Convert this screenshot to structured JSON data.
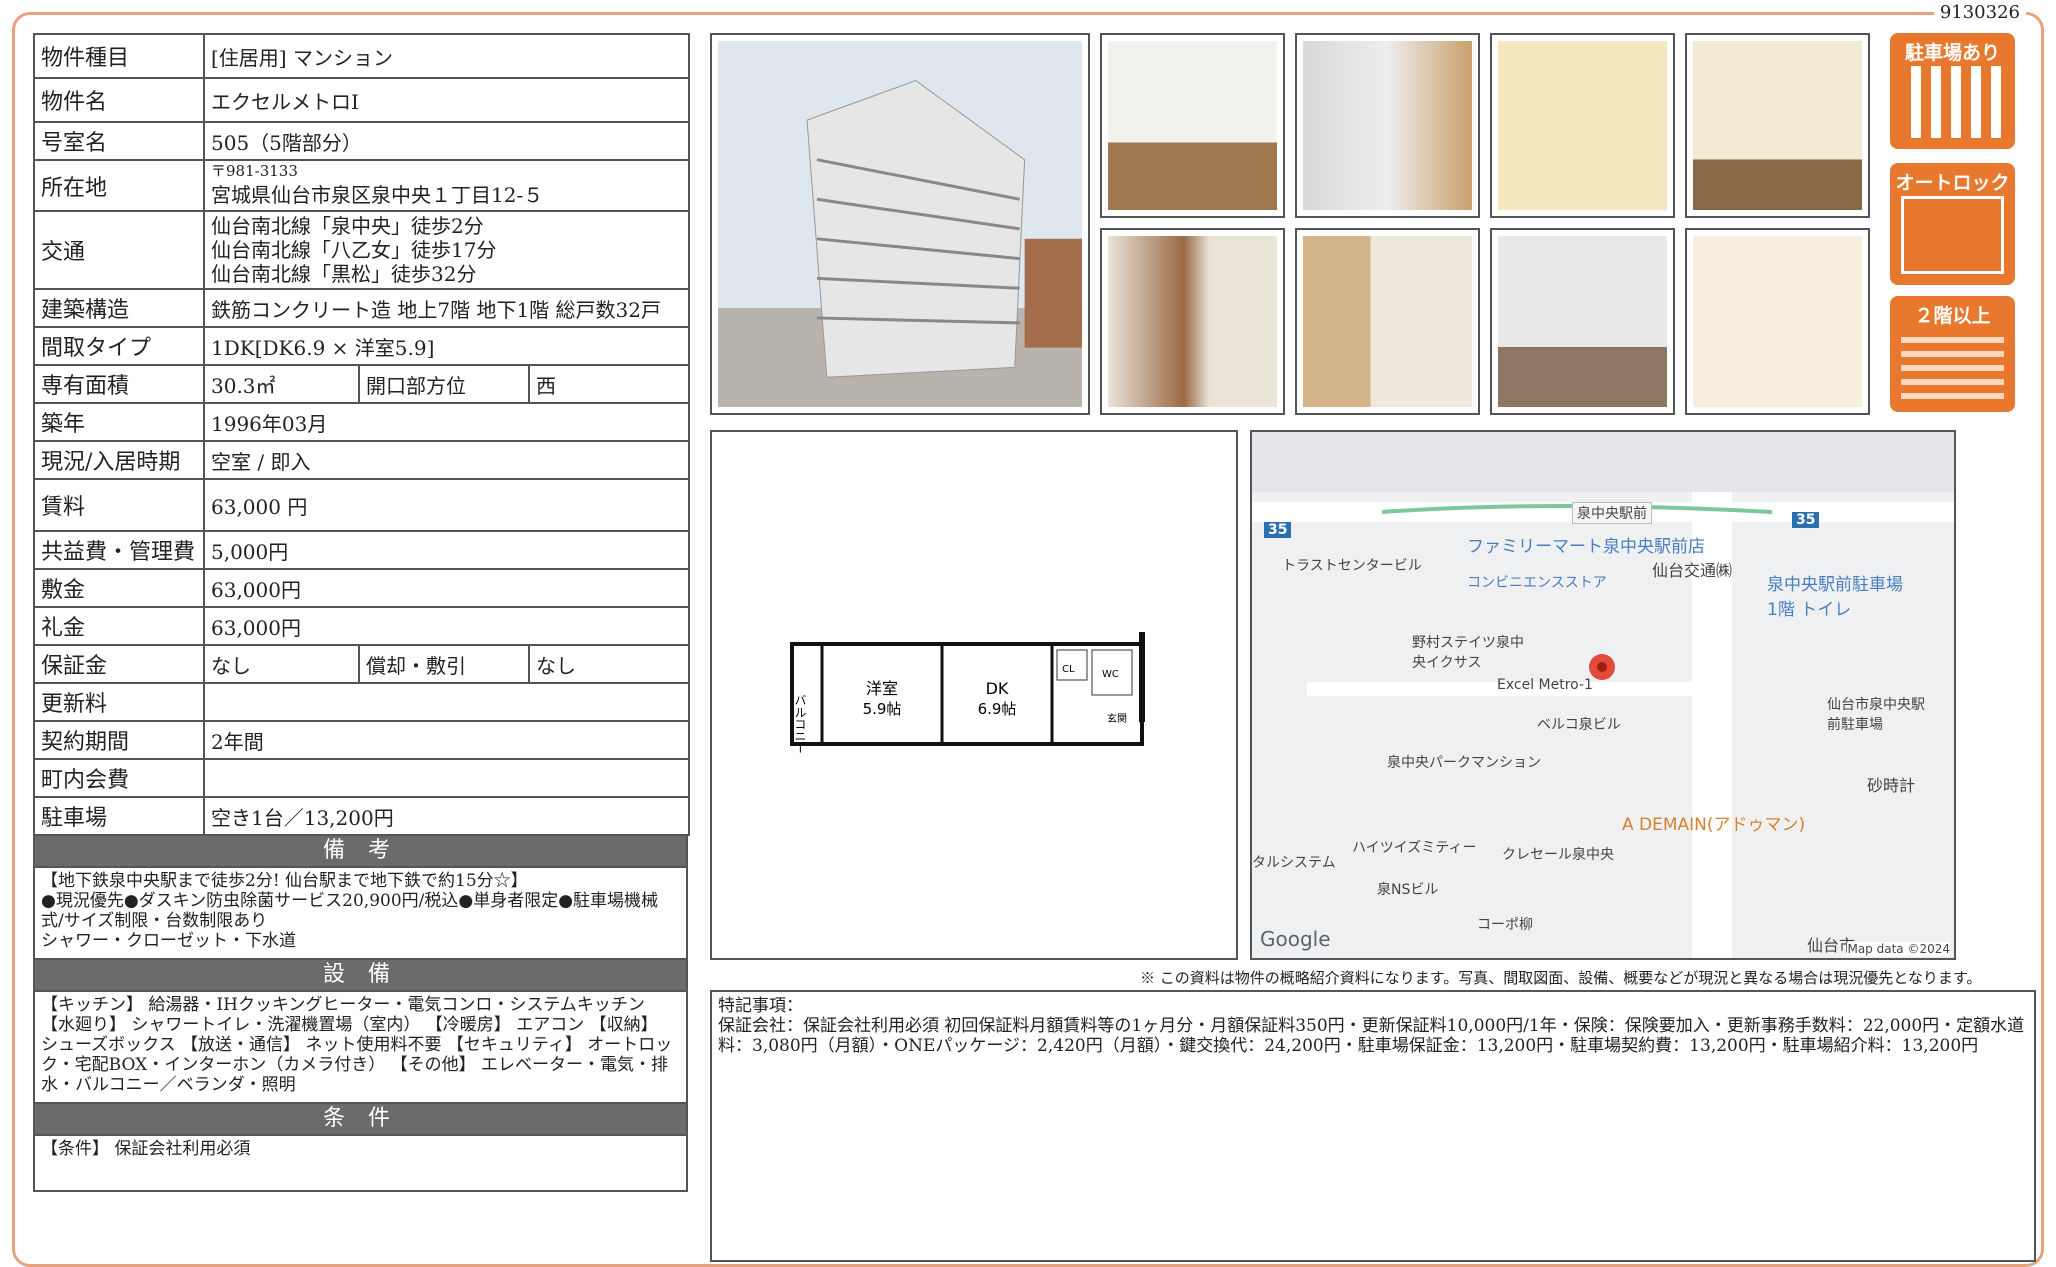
{
  "doc_id": "9130326",
  "property": {
    "type_label": "物件種目",
    "type_value": "[住居用] マンション",
    "name_label": "物件名",
    "name_value": "エクセルメトロI",
    "room_label": "号室名",
    "room_value": "505（5階部分）",
    "address_label": "所在地",
    "postal": "〒981-3133",
    "address_value": "宮城県仙台市泉区泉中央１丁目12-５",
    "transit_label": "交通",
    "transit": [
      "仙台南北線「泉中央」徒歩2分",
      "仙台南北線「八乙女」徒歩17分",
      "仙台南北線「黒松」徒歩32分"
    ],
    "structure_label": "建築構造",
    "structure_value": "鉄筋コンクリート造 地上7階 地下1階 総戸数32戸",
    "layout_label": "間取タイプ",
    "layout_value": "1DK[DK6.9 × 洋室5.9]",
    "area_label": "専有面積",
    "area_value": "30.3㎡",
    "direction_label": "開口部方位",
    "direction_value": "西",
    "built_label": "築年",
    "built_value": "1996年03月",
    "status_label": "現況/入居時期",
    "status_value": "空室 / 即入",
    "rent_label": "賃料",
    "rent_value": "63,000 円",
    "fee_label": "共益費・管理費",
    "fee_value": "5,000円",
    "deposit_label": "敷金",
    "deposit_value": "63,000円",
    "keymoney_label": "礼金",
    "keymoney_value": "63,000円",
    "guarantee_label": "保証金",
    "guarantee_value": "なし",
    "amort_label": "償却・敷引",
    "amort_value": "なし",
    "renewal_label": "更新料",
    "renewal_value": "",
    "term_label": "契約期間",
    "term_value": "2年間",
    "community_label": "町内会費",
    "community_value": "",
    "parking_label": "駐車場",
    "parking_value": "空き1台／13,200円"
  },
  "remarks": {
    "title": "備 考",
    "text": "【地下鉄泉中央駅まで徒歩2分! 仙台駅まで地下鉄で約15分☆】\n●現況優先●ダスキン防虫除菌サービス20,900円/税込●単身者限定●駐車場機械式/サイズ制限・台数制限あり\nシャワー・クローゼット・下水道"
  },
  "facilities": {
    "title": "設 備",
    "text": "【キッチン】 給湯器・IHクッキングヒーター・電気コンロ・システムキッチン 【水廻り】 シャワートイレ・洗濯機置場（室内） 【冷暖房】 エアコン 【収納】 シューズボックス 【放送・通信】 ネット使用料不要 【セキュリティ】 オートロック・宅配BOX・インターホン（カメラ付き） 【その他】 エレベーター・電気・排水・バルコニー／ベランダ・照明"
  },
  "conditions": {
    "title": "条 件",
    "text": "【条件】 保証会社利用必須"
  },
  "tags": [
    "駐車場あり",
    "オートロック",
    "２階以上"
  ],
  "floorplan": {
    "balcony": "バルコニー",
    "western": "洋室",
    "western_size": "5.9帖",
    "dk": "DK",
    "dk_size": "6.9帖",
    "cl": "CL",
    "wc": "WC",
    "entrance": "玄関"
  },
  "map": {
    "station": "泉中央駅前",
    "road_35": "35",
    "labels": [
      "トラストセンタービル",
      "野村ステイツ泉中央イクサス",
      "Excel Metro-1",
      "ベルコ泉ビル",
      "泉中央パークマンション",
      "ハイツイズミティー",
      "クレセール泉中央",
      "泉NSビル",
      "タルシステム",
      "コーポ柳",
      "仙台交通㈱",
      "仙台市泉中央駅前駐車場",
      "砂時計",
      "仙台市"
    ],
    "poi": [
      "ファミリーマート泉中央駅前店",
      "コンビニエンスストア",
      "泉中央駅前駐車場 1階 トイレ",
      "A DEMAIN(アドゥマン)"
    ],
    "google": "Google",
    "credit": "Map data ©2024"
  },
  "note": "※ この資料は物件の概略紹介資料になります。写真、間取図面、設備、概要などが現況と異なる場合は現況優先となります。",
  "special": {
    "title": "特記事項：",
    "text": "保証会社：保証会社利用必須 初回保証料月額賃料等の1ヶ月分・月額保証料350円・更新保証料10,000円/1年・保険：保険要加入・更新事務手数料：22,000円・定額水道料：3,080円（月額）・ONEパッケージ：2,420円（月額）・鍵交換代：24,200円・駐車場保証金：13,200円・駐車場契約費：13,200円・駐車場紹介料：13,200円"
  }
}
